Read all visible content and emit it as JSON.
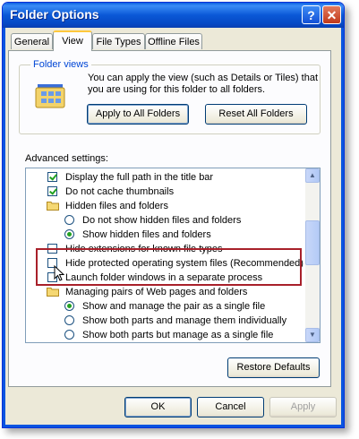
{
  "window": {
    "title": "Folder Options",
    "help_glyph": "?",
    "close_glyph": "✕"
  },
  "tabs": [
    {
      "label": "General",
      "active": false
    },
    {
      "label": "View",
      "active": true
    },
    {
      "label": "File Types",
      "active": false
    },
    {
      "label": "Offline Files",
      "active": false
    }
  ],
  "folder_views": {
    "group_title": "Folder views",
    "description": "You can apply the view (such as Details or Tiles) that you are using for this folder to all folders.",
    "apply_label": "Apply to All Folders",
    "reset_label": "Reset All Folders"
  },
  "advanced": {
    "label": "Advanced settings:",
    "items": [
      {
        "kind": "checkbox",
        "checked": true,
        "indent": 0,
        "label": "Display the full path in the title bar"
      },
      {
        "kind": "checkbox",
        "checked": true,
        "indent": 0,
        "label": "Do not cache thumbnails"
      },
      {
        "kind": "folder",
        "indent": 0,
        "label": "Hidden files and folders"
      },
      {
        "kind": "radio",
        "checked": false,
        "indent": 1,
        "label": "Do not show hidden files and folders"
      },
      {
        "kind": "radio",
        "checked": true,
        "indent": 1,
        "label": "Show hidden files and folders"
      },
      {
        "kind": "checkbox",
        "checked": false,
        "indent": 0,
        "label": "Hide extensions for known file types"
      },
      {
        "kind": "checkbox",
        "checked": false,
        "indent": 0,
        "label": "Hide protected operating system files (Recommended)"
      },
      {
        "kind": "checkbox",
        "checked": false,
        "indent": 0,
        "label": "Launch folder windows in a separate process"
      },
      {
        "kind": "folder",
        "indent": 0,
        "label": "Managing pairs of Web pages and folders"
      },
      {
        "kind": "radio",
        "checked": true,
        "indent": 1,
        "label": "Show and manage the pair as a single file"
      },
      {
        "kind": "radio",
        "checked": false,
        "indent": 1,
        "label": "Show both parts and manage them individually"
      },
      {
        "kind": "radio",
        "checked": false,
        "indent": 1,
        "label": "Show both parts but manage as a single file"
      }
    ],
    "restore_label": "Restore Defaults"
  },
  "footer": {
    "ok_label": "OK",
    "cancel_label": "Cancel",
    "apply_label": "Apply"
  },
  "colors": {
    "titlebar": "#0a58d6",
    "dialog_bg": "#ece9d8",
    "group_title": "#0046d5",
    "highlight_box": "#a8202a"
  }
}
